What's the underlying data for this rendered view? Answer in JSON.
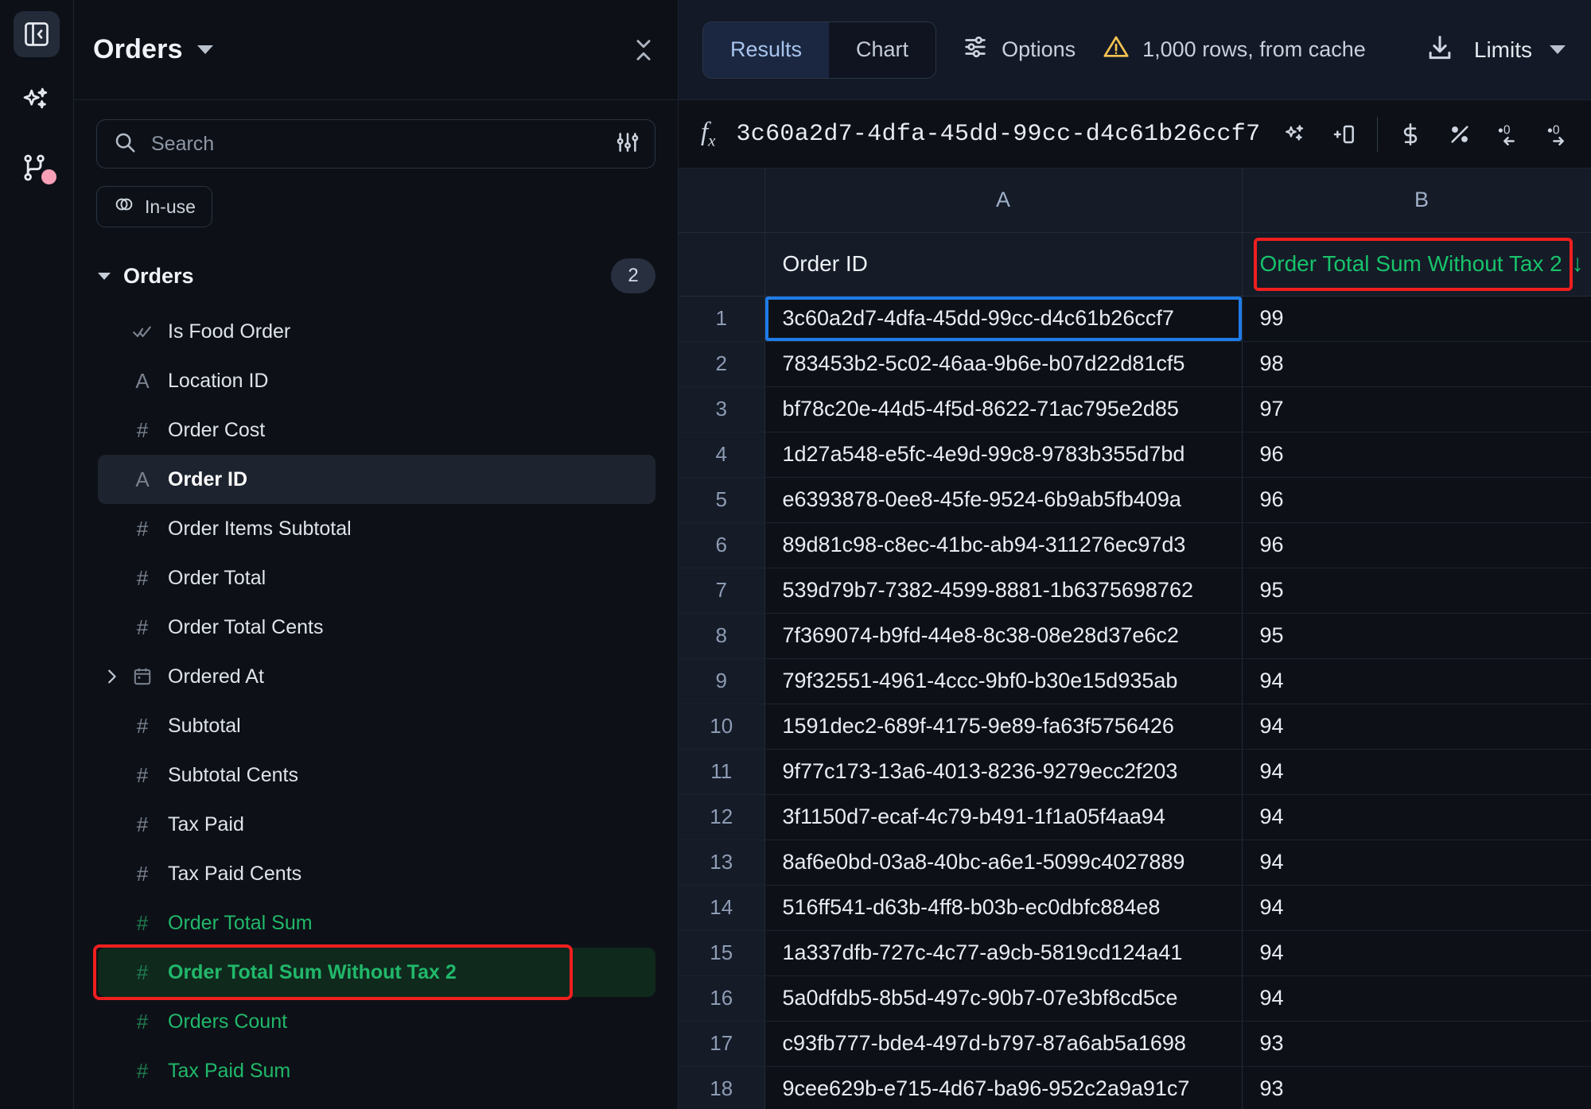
{
  "rail": {
    "collapse_icon": "panel-collapse-icon",
    "items": [
      {
        "name": "ai-sparkles-icon",
        "label": "AI"
      },
      {
        "name": "branch-icon",
        "label": "Branches",
        "has_dot": true
      }
    ]
  },
  "sidebar": {
    "title": "Orders",
    "dropdown_icon": "chevron-down-icon",
    "collapse_icon": "collapse-vertical-icon",
    "search": {
      "value": "",
      "placeholder": "Search",
      "icon": "search-icon",
      "filter_icon": "sliders-icon"
    },
    "chip": {
      "label": "In-use",
      "icon": "toggle-icon"
    },
    "group": {
      "name": "Orders",
      "count": "2"
    },
    "fields": [
      {
        "type": "boolean",
        "icon": "check-check-icon",
        "label": "Is Food Order",
        "state": "normal"
      },
      {
        "type": "string",
        "icon": "A",
        "label": "Location ID",
        "state": "normal"
      },
      {
        "type": "number",
        "icon": "#",
        "label": "Order Cost",
        "state": "normal"
      },
      {
        "type": "string",
        "icon": "A",
        "label": "Order ID",
        "state": "selected"
      },
      {
        "type": "number",
        "icon": "#",
        "label": "Order Items Subtotal",
        "state": "normal"
      },
      {
        "type": "number",
        "icon": "#",
        "label": "Order Total",
        "state": "normal"
      },
      {
        "type": "number",
        "icon": "#",
        "label": "Order Total Cents",
        "state": "normal"
      },
      {
        "type": "date",
        "icon": "calendar-icon",
        "label": "Ordered At",
        "state": "normal",
        "expandable": true
      },
      {
        "type": "number",
        "icon": "#",
        "label": "Subtotal",
        "state": "normal"
      },
      {
        "type": "number",
        "icon": "#",
        "label": "Subtotal Cents",
        "state": "normal"
      },
      {
        "type": "number",
        "icon": "#",
        "label": "Tax Paid",
        "state": "normal"
      },
      {
        "type": "number",
        "icon": "#",
        "label": "Tax Paid Cents",
        "state": "normal"
      },
      {
        "type": "number",
        "icon": "#",
        "label": "Order Total Sum",
        "state": "metric"
      },
      {
        "type": "number",
        "icon": "#",
        "label": "Order Total Sum Without Tax 2",
        "state": "metric-highlight"
      },
      {
        "type": "number",
        "icon": "#",
        "label": "Orders Count",
        "state": "metric"
      },
      {
        "type": "number",
        "icon": "#",
        "label": "Tax Paid Sum",
        "state": "metric"
      }
    ]
  },
  "toolbar": {
    "tabs": [
      {
        "label": "Results",
        "active": true
      },
      {
        "label": "Chart",
        "active": false
      }
    ],
    "options_label": "Options",
    "options_icon": "sliders-icon",
    "warning_icon": "warning-triangle-icon",
    "rows_status": "1,000 rows, from cache",
    "download_icon": "download-icon",
    "limits_label": "Limits",
    "limits_caret_icon": "chevron-down-icon"
  },
  "formula_bar": {
    "fx_label": "fx",
    "value": "3c60a2d7-4dfa-45dd-99cc-d4c61b26ccf7",
    "tools": [
      {
        "name": "ai-sparkles-icon",
        "glyph": "sparkles"
      },
      {
        "name": "insert-column-icon",
        "glyph": "insert-col"
      },
      {
        "name": "currency-format-icon",
        "glyph": "$"
      },
      {
        "name": "percent-format-icon",
        "glyph": "%"
      },
      {
        "name": "decrease-decimal-icon",
        "glyph": ".0←"
      },
      {
        "name": "increase-decimal-icon",
        "glyph": ".0→"
      }
    ]
  },
  "grid": {
    "column_letters": [
      "A",
      "B"
    ],
    "field_headers": [
      {
        "label": "Order ID",
        "kind": "dimension"
      },
      {
        "label": "Order Total Sum Without Tax 2",
        "kind": "metric",
        "sorted": true,
        "sort_icon": "arrow-down-icon",
        "highlighted": true
      }
    ],
    "rows": [
      {
        "n": "1",
        "a": "3c60a2d7-4dfa-45dd-99cc-d4c61b26ccf7",
        "b": "99",
        "selected": true
      },
      {
        "n": "2",
        "a": "783453b2-5c02-46aa-9b6e-b07d22d81cf5",
        "b": "98"
      },
      {
        "n": "3",
        "a": "bf78c20e-44d5-4f5d-8622-71ac795e2d85",
        "b": "97"
      },
      {
        "n": "4",
        "a": "1d27a548-e5fc-4e9d-99c8-9783b355d7bd",
        "b": "96"
      },
      {
        "n": "5",
        "a": "e6393878-0ee8-45fe-9524-6b9ab5fb409a",
        "b": "96"
      },
      {
        "n": "6",
        "a": "89d81c98-c8ec-41bc-ab94-311276ec97d3",
        "b": "96"
      },
      {
        "n": "7",
        "a": "539d79b7-7382-4599-8881-1b6375698762",
        "b": "95"
      },
      {
        "n": "8",
        "a": "7f369074-b9fd-44e8-8c38-08e28d37e6c2",
        "b": "95"
      },
      {
        "n": "9",
        "a": "79f32551-4961-4ccc-9bf0-b30e15d935ab",
        "b": "94"
      },
      {
        "n": "10",
        "a": "1591dec2-689f-4175-9e89-fa63f5756426",
        "b": "94"
      },
      {
        "n": "11",
        "a": "9f77c173-13a6-4013-8236-9279ecc2f203",
        "b": "94"
      },
      {
        "n": "12",
        "a": "3f1150d7-ecaf-4c79-b491-1f1a05f4aa94",
        "b": "94"
      },
      {
        "n": "13",
        "a": "8af6e0bd-03a8-40bc-a6e1-5099c4027889",
        "b": "94"
      },
      {
        "n": "14",
        "a": "516ff541-d63b-4ff8-b03b-ec0dbfc884e8",
        "b": "94"
      },
      {
        "n": "15",
        "a": "1a337dfb-727c-4c77-a9cb-5819cd124a41",
        "b": "94"
      },
      {
        "n": "16",
        "a": "5a0dfdb5-8b5d-497c-90b7-07e3bf8cd5ce",
        "b": "94"
      },
      {
        "n": "17",
        "a": "c93fb777-bde4-497d-b797-87a6ab5a1698",
        "b": "93"
      },
      {
        "n": "18",
        "a": "9cee629b-e715-4d67-ba96-952c2a9a91c7",
        "b": "93"
      }
    ]
  },
  "colors": {
    "metric_green": "#18c26b",
    "annotation_red": "#f01f1f",
    "selection_blue": "#1f7ce8",
    "warning_yellow": "#f5c451",
    "badge_pink": "#f7a0b8"
  }
}
